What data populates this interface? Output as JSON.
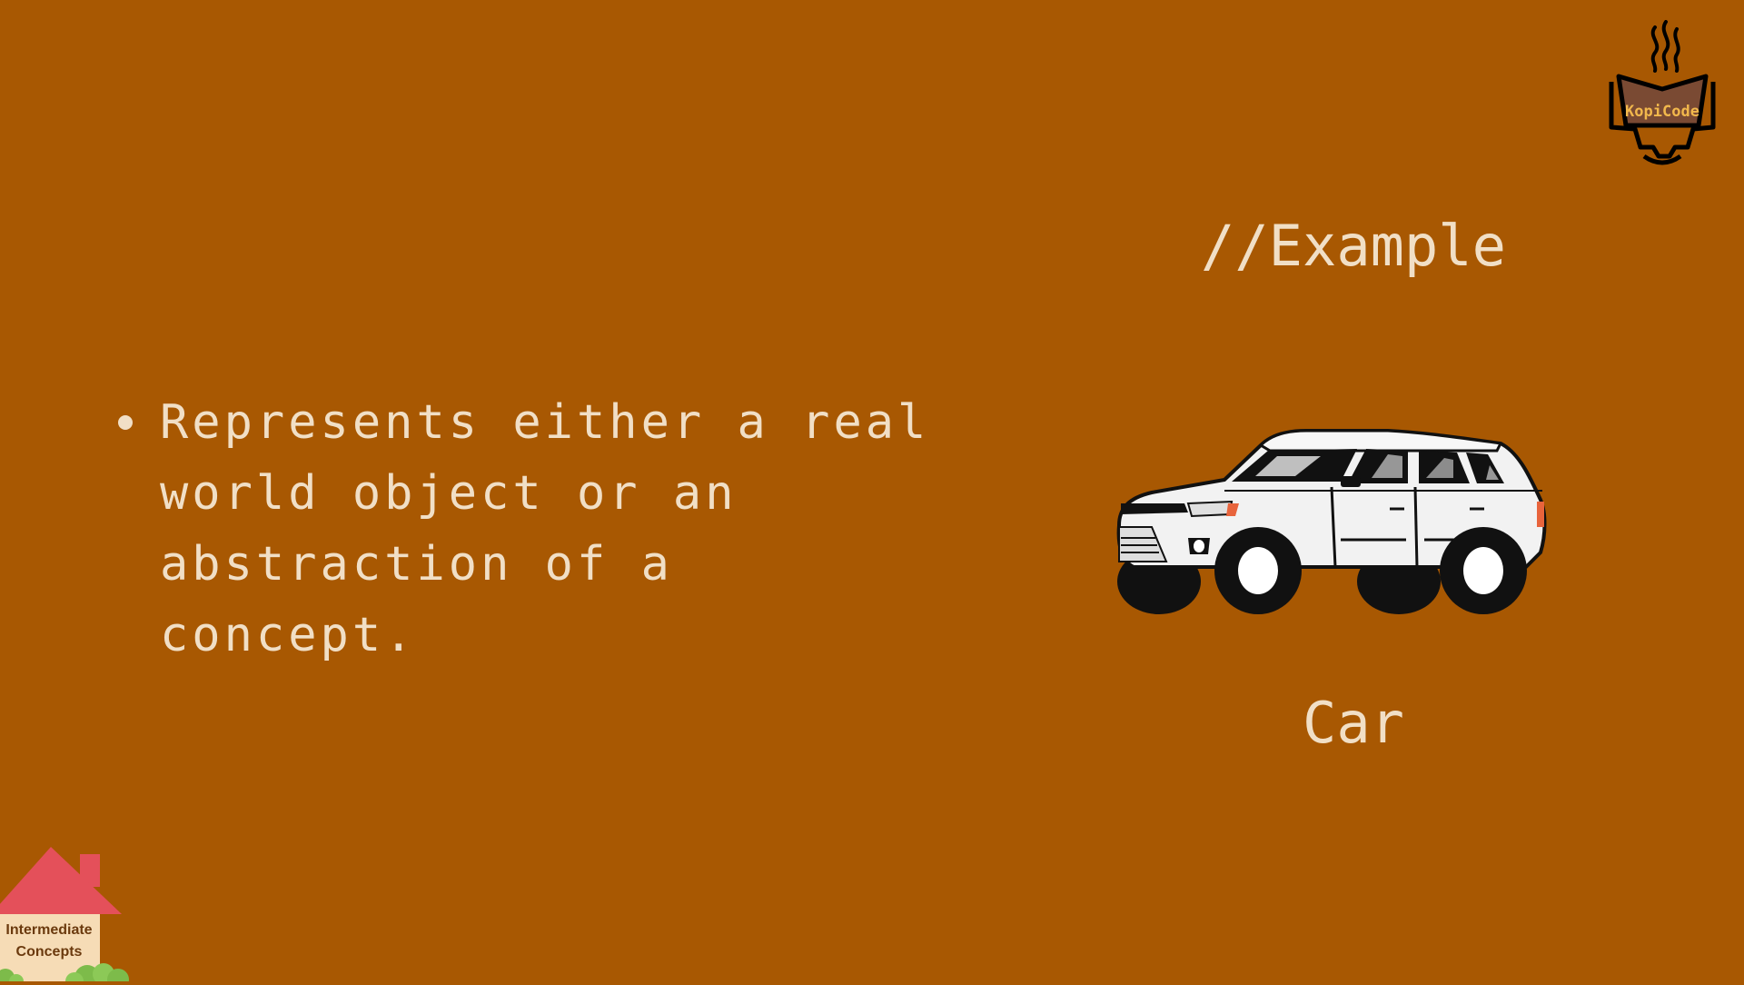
{
  "brand": {
    "name": "KopiCode"
  },
  "example": {
    "heading": "//Example",
    "caption": "Car",
    "image_icon": "car-icon"
  },
  "bullets": [
    {
      "text": "Represents either a real world object or an abstraction of a concept."
    }
  ],
  "badge": {
    "line1": "Intermediate",
    "line2": "Concepts",
    "icon": "house-icon"
  },
  "colors": {
    "background": "#a85802",
    "text": "#f1dfc6",
    "brand_text": "#f2b84c",
    "house_roof": "#e4505a"
  }
}
